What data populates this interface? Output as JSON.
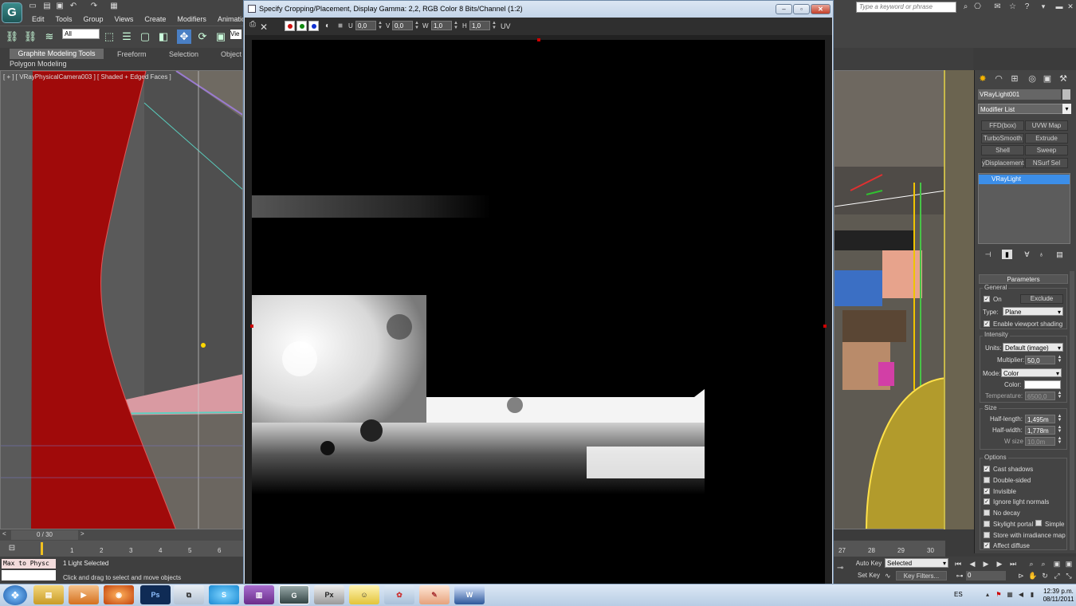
{
  "app": {
    "menu": [
      "Edit",
      "Tools",
      "Group",
      "Views",
      "Create",
      "Modifiers",
      "Animation"
    ],
    "search_placeholder": "Type a keyword or phrase",
    "selection_filter": "All",
    "view_dropdown": "Vie"
  },
  "ribbon": {
    "tabs": [
      "Graphite Modeling Tools",
      "Freeform",
      "Selection",
      "Object"
    ],
    "sub_label": "Polygon Modeling"
  },
  "viewport": {
    "label": "[ + ] [ VRayPhysicalCamera003 ] [ Shaded + Edged Faces ]"
  },
  "dialog": {
    "title": "Specify Cropping/Placement, Display Gamma: 2,2, RGB Color 8 Bits/Channel (1:2)",
    "u_label": "U",
    "u_value": "0,0",
    "v_label": "V",
    "v_value": "0,0",
    "w_label": "W",
    "w_value": "1,0",
    "h_label": "H",
    "h_value": "1,0",
    "uv_label": "UV",
    "channel_colors": [
      "#d01010",
      "#108a10",
      "#1030d0"
    ]
  },
  "command_panel": {
    "object_name": "VRayLight001",
    "modifier_list": "Modifier List",
    "modifier_buttons": [
      "FFD(box)",
      "UVW Map",
      "TurboSmooth",
      "Extrude",
      "Shell",
      "Sweep",
      "yDisplacement",
      "NSurf Sel"
    ],
    "stack_item": "VRayLight",
    "rollout_title": "Parameters",
    "general": {
      "title": "General",
      "on_label": "On",
      "exclude_label": "Exclude",
      "type_label": "Type:",
      "type_value": "Plane",
      "viewport_shading": "Enable viewport shading"
    },
    "intensity": {
      "title": "Intensity",
      "units_label": "Units:",
      "units_value": "Default (image)",
      "multiplier_label": "Multiplier:",
      "multiplier_value": "50,0",
      "mode_label": "Mode:",
      "mode_value": "Color",
      "color_label": "Color:",
      "temperature_label": "Temperature:",
      "temperature_value": "6500,0"
    },
    "size": {
      "title": "Size",
      "half_length_label": "Half-length:",
      "half_length_value": "1,495m",
      "half_width_label": "Half-width:",
      "half_width_value": "1,778m",
      "w_size_label": "W size",
      "w_size_value": "10,0m"
    },
    "options": {
      "title": "Options",
      "items": [
        {
          "label": "Cast shadows",
          "checked": true
        },
        {
          "label": "Double-sided",
          "checked": false
        },
        {
          "label": "Invisible",
          "checked": true
        },
        {
          "label": "Ignore light normals",
          "checked": true
        },
        {
          "label": "No decay",
          "checked": false
        },
        {
          "label": "Skylight portal",
          "checked": false
        },
        {
          "label": "Store with irradiance map",
          "checked": false
        },
        {
          "label": "Affect diffuse",
          "checked": true
        }
      ],
      "simple_label": "Simple"
    }
  },
  "timeline": {
    "slider_label": "0 / 30",
    "ticks_left": [
      "1",
      "2",
      "3",
      "4",
      "5",
      "6"
    ],
    "ticks_right": [
      "27",
      "28",
      "29",
      "30"
    ]
  },
  "status": {
    "maxscript": "Max to Physc",
    "selection": "1 Light Selected",
    "prompt": "Click and drag to select and move objects",
    "auto_key": "Auto Key",
    "set_key": "Set Key",
    "selected_dropdown": "Selected",
    "key_filters": "Key Filters...",
    "frame": "0"
  },
  "taskbar": {
    "language": "ES",
    "time": "12:39 p.m.",
    "date": "08/11/2011"
  },
  "colors": {
    "accent_blue": "#3c8ee8",
    "viewport_red": "#a00a0a",
    "light_color": "#ffffff"
  }
}
